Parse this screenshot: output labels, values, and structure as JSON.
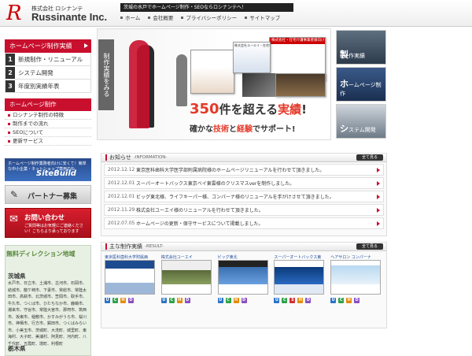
{
  "header": {
    "logo_sub": "株式会社 ロシナンテ",
    "logo_main": "Russinante",
    "logo_inc": "Inc.",
    "tagline": "茨城の水戸でホームページ制作・SEOならロシナンテへ！",
    "nav": [
      "ホーム",
      "会社概要",
      "プライバシーポリシー",
      "サイトマップ"
    ]
  },
  "sidebar": {
    "works_head": "ホームページ制作実績",
    "works_items": [
      {
        "num": "1",
        "label": "新規制作・リニューアル"
      },
      {
        "num": "2",
        "label": "システム開発"
      },
      {
        "num": "3",
        "label": "年度別実績年表"
      }
    ],
    "hp_head": "ホームページ制作",
    "hp_items": [
      "ロシナンテ制作の特徴",
      "制作までの流れ",
      "SEOについて",
      "更新サービス"
    ],
    "sitebuild_text": "ホームページ制作業務者向けに安くて！簡単な中小企業・ネットショップ専用のね",
    "sitebuild_logo": "SiteBuild",
    "partner_label": "パートナー募集",
    "contact_label": "お問い合わせ",
    "contact_sub": "ご質問等はお気軽にご連絡ください！こちらより承っております",
    "free_title": "無料ディレクション地域",
    "region1": "茨城県",
    "cities": "水戸市、日立市、土浦市、古河市、石岡市、結城市、龍ケ崎市、下妻市、常総市、常陸太田市、高萩市、北茨城市、笠間市、取手市、牛久市、つくば市、ひたちなか市、鹿嶋市、潮来市、守谷市、常陸大宮市、那珂市、筑西市、坂東市、稲敷市、かすみがうら市、桜川市、神栖市、行方市、鉾田市、つくばみらい市、小美玉市、茨城町、大洗町、城里町、東海村、大子町、美浦村、阿見町、河内町、八千代町、五霞町、境町、利根町",
    "region2": "栃木県"
  },
  "banner": {
    "tag": "制作実績をみる",
    "headline_num": "350",
    "headline_a": "件を超える",
    "headline_b": "実績",
    "headline_end": "!",
    "sub_a": "確かな",
    "sub_b": "技術",
    "sub_c": "と",
    "sub_d": "経験",
    "sub_e": "でサポート!",
    "shot_title": "株式会社ユーエイ・在宅看護事業者様",
    "shot2_title": "株式会社・在宅介護事業者様向け"
  },
  "tiles": [
    {
      "big": "製",
      "small": "作実績"
    },
    {
      "big": "ホ",
      "small": "ームページ制作"
    },
    {
      "big": "シ",
      "small": "ステム開発"
    }
  ],
  "news": {
    "title": "お知らせ",
    "en": "-INFORMATION-",
    "more": "全て見る",
    "items": [
      {
        "date": "2012.12.12",
        "text": "東京医科歯科大学医学部附属病院様のホームページリニューアルを行わせて頂きました。"
      },
      {
        "date": "2012.12.01",
        "text": "スーパーオートバックス東京ベイ東雲様のクリスマスverを制作しました。"
      },
      {
        "date": "2012.12.01",
        "text": "ビッグ東北様、ライフキーパー様、コンパーナ様のリニューアルを手がけさせて頂きました。"
      },
      {
        "date": "2012.11.29",
        "text": "株式会社ユーエイ様のリニューアルを行わせて頂きました。"
      },
      {
        "date": "2012.07.05",
        "text": "ホームページの更新・保守サービスについて掲載しました。"
      }
    ]
  },
  "works": {
    "title": "主な制作実績",
    "en": "-RESULT-",
    "more": "全て見る",
    "items": [
      {
        "title": "東京医科歯科大学附属病",
        "tags": [
          "U",
          "C",
          "H",
          "D"
        ]
      },
      {
        "title": "株式会社ユーエイ",
        "tags": [
          "U",
          "C",
          "H",
          "D"
        ]
      },
      {
        "title": "ビッグ東北",
        "tags": [
          "U",
          "C",
          "H",
          "D"
        ]
      },
      {
        "title": "スーパーオートバックス東",
        "tags": [
          "U",
          "C",
          "S",
          "H",
          "D"
        ]
      },
      {
        "title": "ヘアサロン コンパーナ",
        "tags": [
          "U",
          "C",
          "H",
          "D"
        ]
      }
    ]
  },
  "colors": {
    "brand_red": "#c8102e",
    "accent_red": "#e43a2a",
    "link_blue": "#1a4a9a"
  }
}
